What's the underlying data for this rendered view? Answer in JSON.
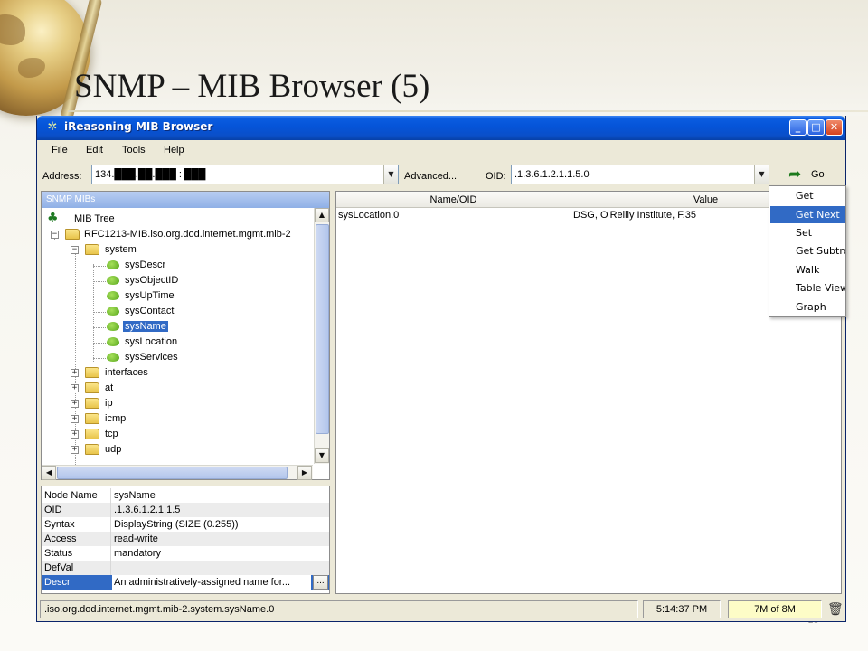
{
  "slide": {
    "title": "SNMP – MIB Browser (5)",
    "page_number": "26"
  },
  "window": {
    "title": "iReasoning MIB Browser",
    "controls": {
      "minimize": "_",
      "maximize": "□",
      "close": "✕"
    }
  },
  "menubar": {
    "items": [
      {
        "label": "File"
      },
      {
        "label": "Edit"
      },
      {
        "label": "Tools"
      },
      {
        "label": "Help"
      }
    ]
  },
  "toolbar": {
    "address_label": "Address:",
    "address_value": "134.███.██.███ : ███",
    "advanced_label": "Advanced...",
    "oid_label": "OID:",
    "oid_value": ".1.3.6.1.2.1.1.5.0",
    "go_label": "Go"
  },
  "tree": {
    "header": "SNMP MIBs",
    "root": "MIB Tree",
    "module": "RFC1213-MIB.iso.org.dod.internet.mgmt.mib-2",
    "system": "system",
    "system_children": [
      {
        "label": "sysDescr",
        "selected": false
      },
      {
        "label": "sysObjectID",
        "selected": false
      },
      {
        "label": "sysUpTime",
        "selected": false
      },
      {
        "label": "sysContact",
        "selected": false
      },
      {
        "label": "sysName",
        "selected": true
      },
      {
        "label": "sysLocation",
        "selected": false
      },
      {
        "label": "sysServices",
        "selected": false
      }
    ],
    "groups": [
      "interfaces",
      "at",
      "ip",
      "icmp",
      "tcp",
      "udp"
    ]
  },
  "properties": [
    {
      "key": "Node Name",
      "value": "sysName"
    },
    {
      "key": "OID",
      "value": ".1.3.6.1.2.1.1.5"
    },
    {
      "key": "Syntax",
      "value": "DisplayString (SIZE (0.255))"
    },
    {
      "key": "Access",
      "value": "read-write"
    },
    {
      "key": "Status",
      "value": "mandatory"
    },
    {
      "key": "DefVal",
      "value": ""
    },
    {
      "key": "Descr",
      "value": "An administratively-assigned name for..."
    }
  ],
  "result_table": {
    "columns": [
      "Name/OID",
      "Value"
    ],
    "rows": [
      {
        "name": "sysLocation.0",
        "value": "DSG, O'Reilly Institute, F.35"
      }
    ]
  },
  "operations_menu": {
    "items": [
      {
        "label": "Get",
        "highlighted": false
      },
      {
        "label": "Get Next",
        "highlighted": true
      },
      {
        "label": "Set",
        "highlighted": false
      },
      {
        "label": "Get Subtree",
        "highlighted": false
      },
      {
        "label": "Walk",
        "highlighted": false
      },
      {
        "label": "Table View",
        "highlighted": false
      },
      {
        "label": "Graph",
        "highlighted": false
      }
    ]
  },
  "statusbar": {
    "path": ".iso.org.dod.internet.mgmt.mib-2.system.sysName.0",
    "time": "5:14:37 PM",
    "memory": "7M of 8M"
  },
  "colors": {
    "titlebar": "#0554d8",
    "selection": "#316ac5",
    "memory_bg": "#fdfcc7"
  }
}
